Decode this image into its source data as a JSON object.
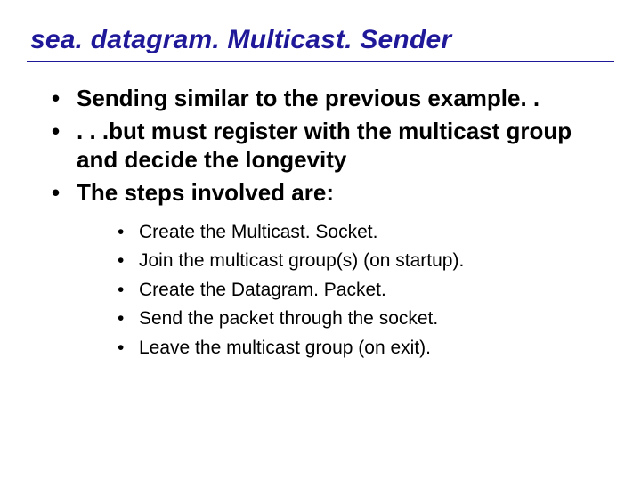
{
  "title": "sea. datagram. Multicast. Sender",
  "bullets": [
    "Sending similar to the previous example. .",
    ". . .but must register with the multicast group and decide the longevity",
    "The steps involved are:"
  ],
  "sub_bullets": [
    "Create the Multicast. Socket.",
    "Join the multicast group(s) (on startup).",
    "Create the Datagram. Packet.",
    "Send the packet through the socket.",
    "Leave the multicast group (on exit)."
  ]
}
